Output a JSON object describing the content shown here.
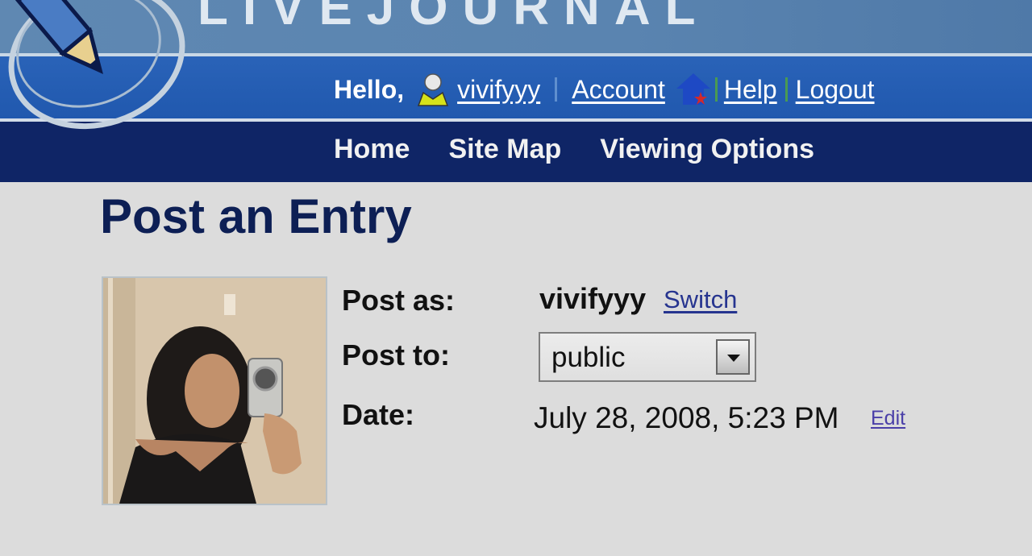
{
  "header": {
    "logo_text": "LIVEJOURNAL",
    "hello_label": "Hello,",
    "username": "vivifyyy",
    "account_label": "Account",
    "help_label": "Help",
    "logout_label": "Logout"
  },
  "nav": {
    "items": [
      "Home",
      "Site Map",
      "Viewing Options"
    ]
  },
  "main": {
    "title": "Post an Entry",
    "post_as_label": "Post as:",
    "post_as_value": "vivifyyy",
    "switch_label": "Switch",
    "post_to_label": "Post to:",
    "post_to_value": "public",
    "date_label": "Date:",
    "date_value": "July 28, 2008, 5:23 PM",
    "edit_label": "Edit"
  },
  "icons": {
    "logo": "pencil-logo-icon",
    "user": "user-icon",
    "home": "home-icon",
    "dropdown": "chevron-down-icon"
  },
  "colors": {
    "top_band": "#5a84b0",
    "user_bar": "#2058ae",
    "nav_bar": "#0f2566",
    "title": "#0d1f55",
    "link": "#26348f"
  }
}
